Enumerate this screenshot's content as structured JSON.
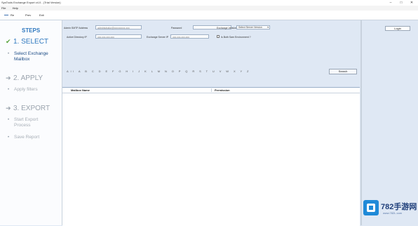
{
  "window": {
    "title": "SysTools Exchange Export v4.0 - (Trial Version)",
    "controls": [
      "–",
      "□",
      "✕"
    ]
  },
  "menu": {
    "items": [
      "File",
      "Help"
    ]
  },
  "toolbar": {
    "items": [
      "Re",
      "Prev",
      "Exit"
    ]
  },
  "sidebar": {
    "title": "STEPS",
    "steps": [
      {
        "label": "1. SELECT",
        "mark": "✔",
        "sub": [
          "Select Exchange",
          "Mailbox"
        ]
      },
      {
        "label": "2. APPLY",
        "mark": "➜",
        "sub": [
          "Apply filters"
        ]
      },
      {
        "label": "3. EXPORT",
        "mark": "➜",
        "sub": [
          "Start Export",
          "Process",
          "Save Report"
        ]
      }
    ]
  },
  "form": {
    "server_label": "Admin SMTP Address",
    "server_value": "administrator@xxxxxxxxx.xxx",
    "password_label": "Password",
    "password_value": "",
    "version_label": "Exchange Version",
    "version_value": "Select Server Version",
    "domain_label": "Active Directory IP",
    "domain_value": "xxx.xxx.xxx.xxx",
    "exchange_label": "Exchange Server IP",
    "exchange_value": "xxx.xxx.xxx.xxx",
    "checkbox_label": "Is Both Sam Environment ?",
    "alphabet": "All  A  B  C  D  E  F  G  H  I  J  K  L  M  N  O  P  Q  R  S  T  U  V  W  X  Y  Z",
    "search_button": "Search"
  },
  "grid": {
    "columns": [
      "Mailbox Name",
      "Permission"
    ]
  },
  "right": {
    "login_button": "Login"
  },
  "watermark": {
    "brand": "782手游网",
    "url": "www.782L.com"
  }
}
